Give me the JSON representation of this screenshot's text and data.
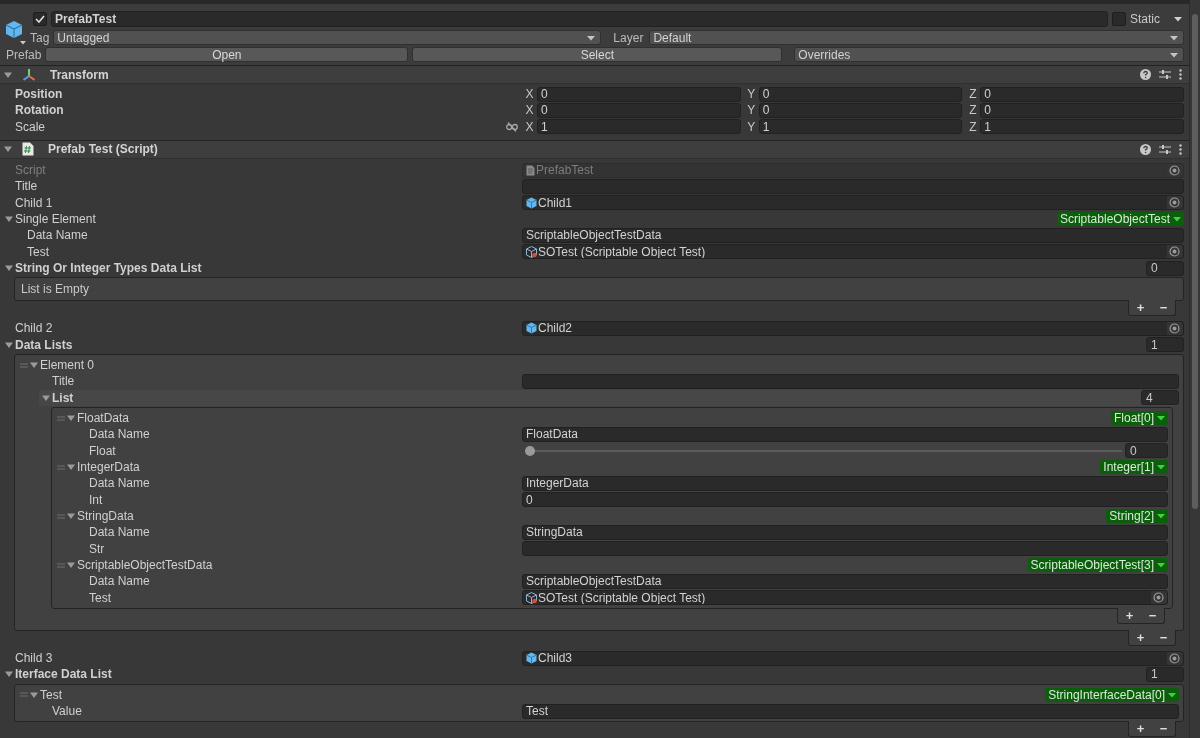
{
  "header": {
    "active": true,
    "name": "PrefabTest",
    "static": false,
    "static_label": "Static",
    "tag_label": "Tag",
    "tag": "Untagged",
    "layer_label": "Layer",
    "layer": "Default",
    "prefab_label": "Prefab",
    "prefab_buttons": [
      "Open",
      "Select"
    ],
    "overrides": "Overrides"
  },
  "components": [
    {
      "kind": "transform",
      "title": "Transform",
      "expanded": true,
      "rows": [
        {
          "kind": "vector",
          "label": "Position",
          "overridden": true,
          "axes": [
            {
              "axis": "X",
              "value": "0"
            },
            {
              "axis": "Y",
              "value": "0"
            },
            {
              "axis": "Z",
              "value": "0"
            }
          ]
        },
        {
          "kind": "vector",
          "label": "Rotation",
          "overridden": true,
          "axes": [
            {
              "axis": "X",
              "value": "0"
            },
            {
              "axis": "Y",
              "value": "0"
            },
            {
              "axis": "Z",
              "value": "0"
            }
          ]
        },
        {
          "kind": "scale",
          "label": "Scale",
          "overridden": false,
          "axes": [
            {
              "axis": "X",
              "value": "1"
            },
            {
              "axis": "Y",
              "value": "1"
            },
            {
              "axis": "Z",
              "value": "1"
            }
          ]
        }
      ]
    },
    {
      "kind": "script",
      "title": "Prefab Test (Script)",
      "expanded": true,
      "fields": [
        {
          "kind": "script_ref",
          "label": "Script",
          "overridden": false,
          "value": "PrefabTest"
        },
        {
          "kind": "text",
          "label": "Title",
          "overridden": false
        },
        {
          "kind": "object_ref",
          "label": "Child 1",
          "overridden": false,
          "value": "Child1"
        },
        {
          "kind": "foldout",
          "label": "Single Element",
          "overridden": false,
          "expanded": true,
          "badge": "ScriptableObjectTest",
          "children": [
            {
              "kind": "text",
              "label": "Data Name",
              "overridden": false,
              "value": "ScriptableObjectTestData"
            },
            {
              "kind": "asset_ref",
              "label": "Test",
              "overridden": false,
              "value": "SOTest (Scriptable Object Test)"
            }
          ]
        },
        {
          "kind": "list",
          "label": "String Or Integer Types Data List",
          "overridden": true,
          "expanded": true,
          "count": "0",
          "empty_text": "List is Empty",
          "add": "+",
          "remove": "−"
        },
        {
          "kind": "object_ref",
          "label": "Child 2",
          "overridden": false,
          "value": "Child2"
        },
        {
          "kind": "list",
          "label": "Data Lists",
          "overridden": true,
          "expanded": true,
          "count": "1",
          "add": "+",
          "remove": "−",
          "items": [
            {
              "label": "Element 0",
              "expanded": true,
              "children": [
                {
                  "kind": "text",
                  "label": "Title",
                  "overridden": false
                },
                {
                  "kind": "list",
                  "label": "List",
                  "overridden": true,
                  "expanded": true,
                  "count": "4",
                  "add": "+",
                  "remove": "−",
                  "items": [
                    {
                      "label": "FloatData",
                      "expanded": true,
                      "badge": "Float[0]",
                      "children": [
                        {
                          "kind": "text",
                          "label": "Data Name",
                          "overridden": false,
                          "value": "FloatData"
                        },
                        {
                          "kind": "slider",
                          "label": "Float",
                          "overridden": false,
                          "level": 0,
                          "value": "0"
                        }
                      ]
                    },
                    {
                      "label": "IntegerData",
                      "expanded": true,
                      "badge": "Integer[1]",
                      "children": [
                        {
                          "kind": "text",
                          "label": "Data Name",
                          "overridden": false,
                          "value": "IntegerData"
                        },
                        {
                          "kind": "text",
                          "label": "Int",
                          "overridden": false,
                          "value": "0"
                        }
                      ]
                    },
                    {
                      "label": "StringData",
                      "expanded": true,
                      "badge": "String[2]",
                      "children": [
                        {
                          "kind": "text",
                          "label": "Data Name",
                          "overridden": false,
                          "value": "StringData"
                        },
                        {
                          "kind": "text",
                          "label": "Str",
                          "overridden": false
                        }
                      ]
                    },
                    {
                      "label": "ScriptableObjectTestData",
                      "expanded": true,
                      "badge": "ScriptableObjectTest[3]",
                      "children": [
                        {
                          "kind": "text",
                          "label": "Data Name",
                          "overridden": false,
                          "value": "ScriptableObjectTestData"
                        },
                        {
                          "kind": "asset_ref",
                          "label": "Test",
                          "overridden": false,
                          "value": "SOTest (Scriptable Object Test)"
                        }
                      ]
                    }
                  ]
                }
              ]
            }
          ]
        },
        {
          "kind": "object_ref",
          "label": "Child 3",
          "overridden": false,
          "value": "Child3"
        },
        {
          "kind": "list",
          "label": "Iterface Data List",
          "overridden": true,
          "expanded": true,
          "count": "1",
          "add": "+",
          "remove": "−",
          "items": [
            {
              "label": "Test",
              "expanded": true,
              "badge": "StringInterfaceData[0]",
              "children": [
                {
                  "kind": "text",
                  "label": "Value",
                  "overridden": false,
                  "value": "Test"
                }
              ]
            }
          ]
        }
      ]
    }
  ]
}
